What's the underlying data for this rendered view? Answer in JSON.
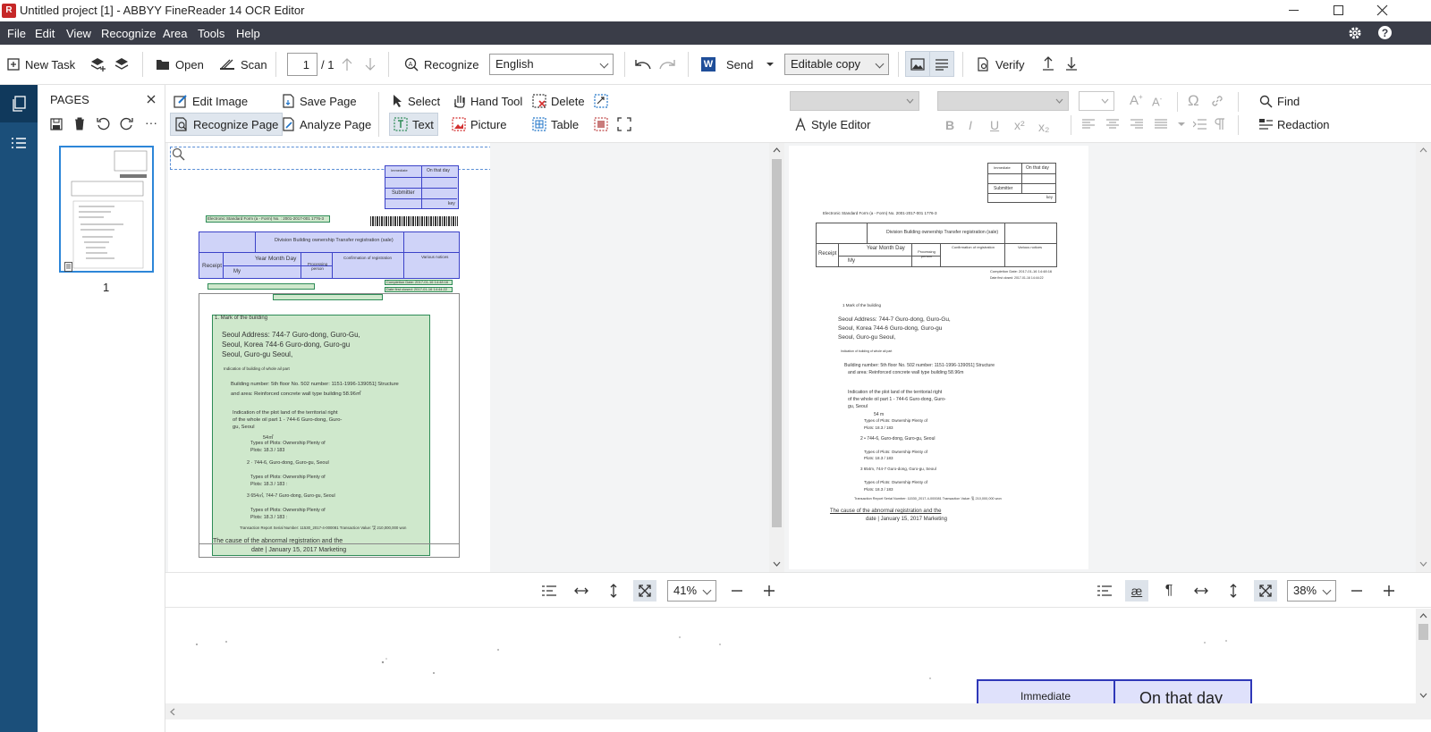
{
  "window": {
    "title": "Untitled project [1] - ABBYY FineReader 14 OCR Editor",
    "app_icon": "abbyy-icon",
    "controls": [
      "minimize-icon",
      "restore-icon",
      "close-icon"
    ]
  },
  "menu": {
    "items": [
      "File",
      "Edit",
      "View",
      "Recognize",
      "Area",
      "Tools",
      "Help"
    ]
  },
  "toolbar": {
    "new_task": "New Task",
    "open": "Open",
    "scan": "Scan",
    "page_number": "1",
    "page_total": "/ 1",
    "recognize": "Recognize",
    "language": "English",
    "send": "Send",
    "output_mode": "Editable copy",
    "verify": "Verify"
  },
  "pages_panel": {
    "title": "PAGES",
    "thumb_label": "1"
  },
  "image_tools": {
    "edit_image": "Edit Image",
    "save_page": "Save Page",
    "recognize_page": "Recognize Page",
    "analyze_page": "Analyze Page",
    "select": "Select",
    "hand_tool": "Hand Tool",
    "delete": "Delete",
    "text": "Text",
    "picture": "Picture",
    "table": "Table"
  },
  "text_tools": {
    "style_editor": "Style Editor",
    "find": "Find",
    "redaction": "Redaction",
    "format_buttons": [
      "B",
      "I",
      "U",
      "x²",
      "x₂"
    ]
  },
  "image_doc": {
    "header_cells": [
      "Immediate",
      "On that day",
      "Submitter",
      "key"
    ],
    "form_label": "Electronic Standard Form (a - Form) No. : 2001-2017-001 1776-3",
    "title_row": "Division Building ownership Transfer registration (sale)",
    "receipt": "Receipt",
    "year_month_day": "Year Month Day",
    "processing": "Processing person",
    "confirmation": "Confirmation of registration",
    "various": "Various notices",
    "my": "My",
    "completion": "Completion Date: 2017-01-16 14:48:16",
    "first_closed": "Date first closed: 2017-01-16 14:44:22",
    "section_1": "1. Mark of the building",
    "addr_1": "Seoul Address: 744-7 Guro-dong, Guro-Gu,",
    "addr_2": "Seoul, Korea 744-6 Guro-dong, Guro-gu",
    "addr_3": "Seoul, Guro-gu Seoul,",
    "indication_small": "Indication of building of whole ail part",
    "building_1": "Building number: 5th floor No. 502 number: 1151-1996-139051] Structure",
    "building_2": "and area: Reinforced concrete wall type building 58.96㎡",
    "plot_1": "Indication of the plot land of the territorial right",
    "plot_2": "of the whole oil part 1 - 744-6 Guro-dong, Guro-",
    "plot_3": "gu, Seoul",
    "m54": "54㎡",
    "types_1a": "Types of Plots: Ownership Plenty of",
    "types_1b": "Plots: 18.3 / 183",
    "line_2": "2 · 744-6, Guro-dong, Guro-gu, Seoul",
    "types_2a": "Types of Plots: Ownership Plenty of",
    "types_2b": "Plots: 18.3 / 183    :",
    "line_3": "3 654㎡, 744-7 Guro-dong, Guro-gu, Seoul",
    "types_3a": "Types of Plots: Ownership Plenty of",
    "types_3b": "Plots: 18.3 / 183    :",
    "transaction": "Transaction Report Serial Number: 11530_2017-4-000081 Transaction Value: 및 210,000,000 won",
    "cause_1": "The cause of the abnormal registration and the",
    "cause_2": "date | January 15, 2017 Marketing"
  },
  "text_doc": {
    "header_cells": [
      "Immediate",
      "On that day",
      "Submitter",
      "key"
    ],
    "form_label": "Electronic Standard Form (a - Form) No. 2001-2017-001 1776-3",
    "title_row": "Division Building ownership Transfer registration (sale)",
    "receipt": "Receipt",
    "year_month_day": "Year Month Day",
    "processing": "Processing person",
    "confirmation": "Confirmation of registration",
    "various": "Various notices",
    "my": "My",
    "completion": "Completion Date: 2017-01-16 14:48:16",
    "first_closed": "Date first closed: 2017-01-16 14:44:22",
    "section_1": "1 Mark of the building",
    "addr_1": "Seoul Address: 744-7 Guro-dong, Guro-Gu,",
    "addr_2": "Seoul, Korea 744-6 Guro-dong, Guro-gu",
    "addr_3": "Seoul, Guro-gu Seoul,",
    "indication_small": "Indication of building of whole ail part",
    "building_1": "Building number: 5th floor No. 502 number: 1151-1996-139051] Structure",
    "building_2": "and area: Reinforced concrete wall type building 58.96m",
    "plot_1": "Indication of the plot land of the territorial right",
    "plot_2": "of the whole oil part 1 - 744-6 Guro-dong, Guro-",
    "plot_3": "gu, Seoul",
    "m54": "54 m",
    "types_1a": "Types of Plots: Ownership Plenty of",
    "types_1b": "Plots: 18.3 / 183",
    "line_2": "2 • 744-6, Guro-dong, Guro-gu, Seoul",
    "types_2a": "Types of Plots: Ownership Plenty of",
    "types_2b": "Plots: 18.3 / 183",
    "line_3": "3 654m, 744-7 Guro-dong, Guro-gu, Seoul",
    "types_3a": "Types of Plots: Ownership Plenty of",
    "types_3b": "Plots: 18.3 / 183",
    "transaction": "Transaction Report Serial Number: 11530_2017-4-000081 Transaction Value: 및 210,000,000 won",
    "cause_1": "The cause of the abnormal registration and the",
    "cause_2": "date | January 15, 2017 Marketing"
  },
  "zoom": {
    "image_zoom": "41%",
    "text_zoom": "38%"
  },
  "bottom_view": {
    "cell_1": "Immediate",
    "cell_2": "On that day"
  },
  "colors": {
    "menubar": "#3a3d48",
    "leftnav": "#1b4f7a",
    "text_area_fill": "#cfe8cc",
    "table_area_fill": "#cfd3f8",
    "table_area_border": "#3b42c8",
    "barcode_area": "#6b6b6b"
  }
}
